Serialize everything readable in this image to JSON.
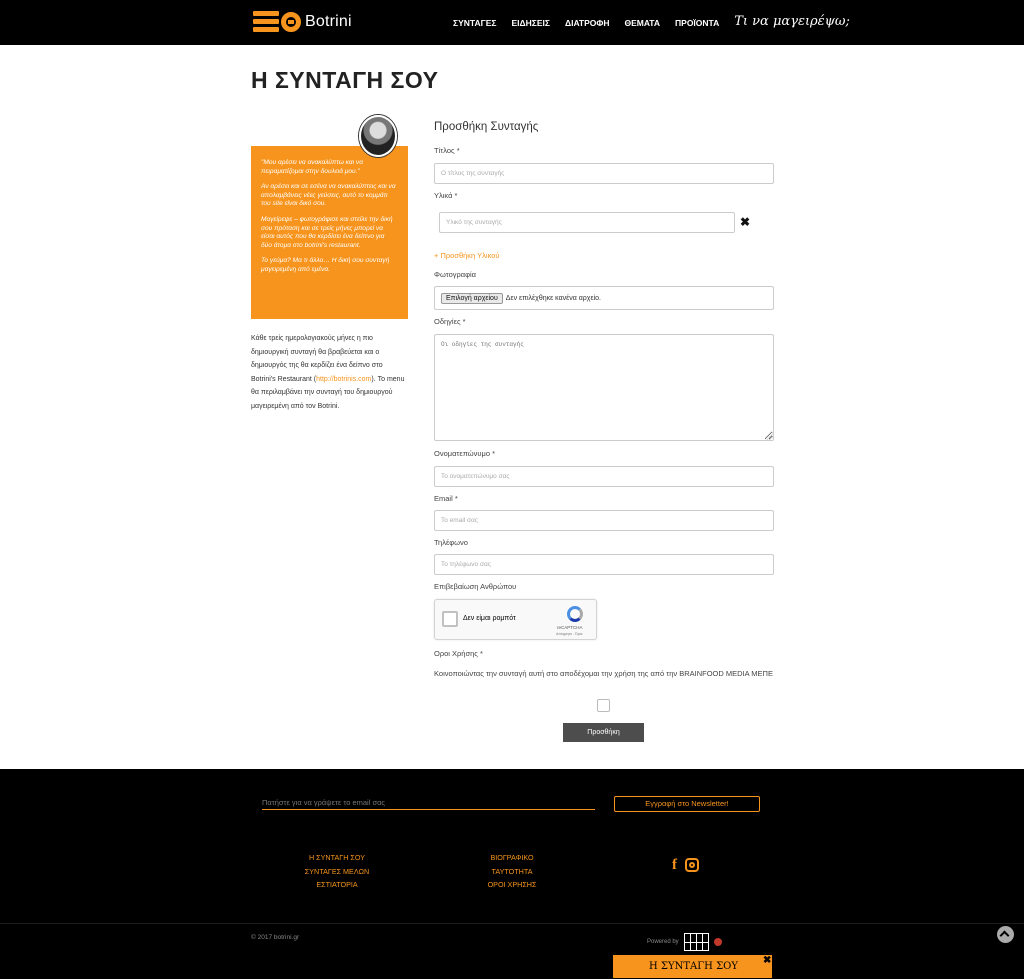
{
  "header": {
    "logo_text": "Botrini",
    "nav": [
      "ΣΥΝΤΑΓΕΣ",
      "ΕΙΔΗΣΕΙΣ",
      "ΔΙΑΤΡΟΦΗ",
      "ΘΕΜΑΤΑ",
      "ΠΡΟΪΟΝΤΑ"
    ],
    "nav_special": "Τι να μαγειρέψω;"
  },
  "page": {
    "title": "Η ΣΥΝΤΑΓΗ ΣΟΥ"
  },
  "sidebar": {
    "promo": [
      "\"Μου αρέσει να ανακαλύπτω και να πειραματίζομαι στην δουλειά μου.\"",
      "Αν αρέσει και σε εσένα να ανακαλύπτεις και να απολαμβάνεις νέες γεύσεις, αυτό το κομμάτι του site είναι δικό σου.",
      "Μαγείρεψε – φωτογράφισε και στείλε την δική σου πρόταση και σε τρείς μήνες μπορεί να είσαι αυτός που θα κερδίσει ένα δείπνο για δύο άτομα στο botrini's restaurant.",
      "Το γεύμα? Μα τι άλλο… Η δική σου συνταγή μαγειρεμένη από εμένα."
    ],
    "note_part1": "Κάθε τρείς ημερολογιακούς μήνες η πιο δημιουργική συνταγή θα βραβεύεται και ο δημιουργός της θα κερδίζει ένα δείπνο στο Botrini's Restaurant (",
    "note_link": "http://botrinis.com",
    "note_part2": "). Το menu θα περιλαμβάνει την συνταγή του δημιουργού μαγειρεμένη από τον Botrini."
  },
  "form": {
    "heading": "Προσθήκη Συνταγής",
    "title_label": "Τίτλος *",
    "title_placeholder": "Ο τίτλος της συνταγής",
    "ingredients_label": "Υλικά *",
    "ingredient_placeholder": "Υλικό της συνταγής",
    "remove_symbol": "✖",
    "add_ingredient": "+ Προσθήκη Υλικού",
    "photo_label": "Φωτογραφία",
    "file_button": "Επιλογή αρχείου",
    "file_status": "Δεν επιλέχθηκε κανένα αρχείο.",
    "instructions_label": "Οδηγίες *",
    "instructions_placeholder": "Οι οδηγίες της συνταγής",
    "name_label": "Ονοματεπώνυμο *",
    "name_placeholder": "Το ονοματεπώνυμο σας",
    "email_label": "Email *",
    "email_placeholder": "Το email σας",
    "phone_label": "Τηλέφωνο",
    "phone_placeholder": "Το τηλέφωνο σας",
    "captcha_label": "Επιβεβαίωση Ανθρώπου",
    "captcha_text": "Δεν είμαι ρομπότ",
    "captcha_brand": "reCAPTCHA",
    "captcha_links": "Απόρρητο - Όροι",
    "terms_label": "Οροι Χρήσης *",
    "terms_text": "Κοινοποιώντας την συνταγή αυτή στο αποδέχομαι την χρήση της από την BRAINFOOD MEDIA ΜΕΠΕ",
    "submit_label": "Προσθήκη"
  },
  "footer": {
    "newsletter_placeholder": "Πατήστε για να γράψετε το email σας",
    "newsletter_button": "Εγγραφή στο Newsletter!",
    "col1": [
      "Η ΣΥΝΤΑΓΗ ΣΟΥ",
      "ΣΥΝΤΑΓΕΣ ΜΕΛΩΝ",
      "ΕΣΤΙΑΤΟΡΙΑ"
    ],
    "col2": [
      "ΒΙΟΓΡΑΦΙΚΟ",
      "ΤΑΥΤΟΤΗΤΑ",
      "ΟΡΟΙ ΧΡΗΣΗΣ"
    ],
    "social_fb": "f",
    "copyright": "© 2017 botrini.gr",
    "powered": "Powered by"
  },
  "sticky": {
    "label": "Η ΣΥΝΤΑΓΗ ΣΟΥ",
    "close": "✖"
  },
  "colors": {
    "accent": "#f7941d",
    "header_bg": "#000000",
    "submit_bg": "#4d4d4d"
  },
  "icons": [
    "facebook-icon",
    "instagram-icon",
    "close-icon",
    "scroll-top-icon",
    "recaptcha-icon"
  ]
}
